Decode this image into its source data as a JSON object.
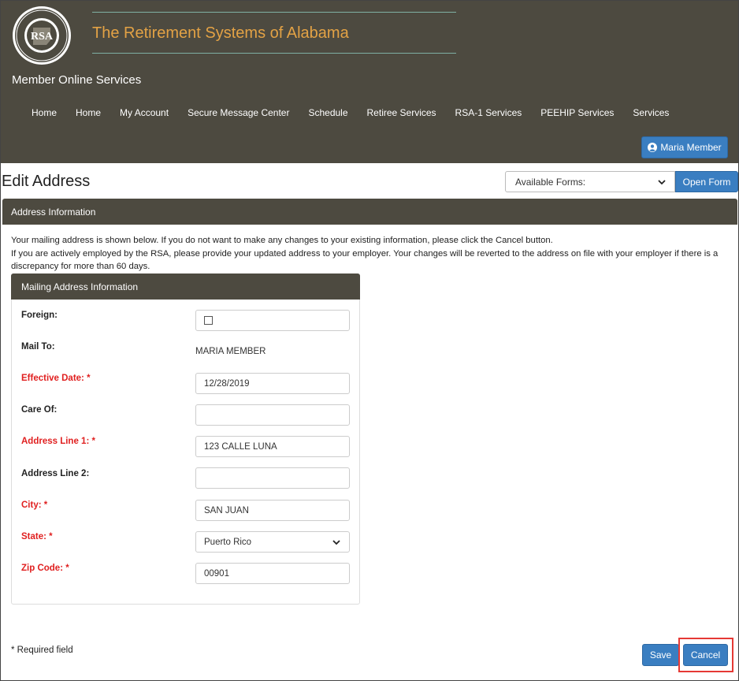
{
  "header": {
    "logo_icon": "rsa-seal-logo",
    "site_title": "The Retirement Systems of Alabama",
    "app_title": "Member Online Services",
    "nav": [
      {
        "label": "Home"
      },
      {
        "label": "Home"
      },
      {
        "label": "My Account"
      },
      {
        "label": "Secure Message Center"
      },
      {
        "label": "Schedule"
      },
      {
        "label": "Retiree Services"
      },
      {
        "label": "RSA-1 Services"
      },
      {
        "label": "PEEHIP Services"
      },
      {
        "label": "Services"
      }
    ],
    "member_button": {
      "label": "Maria Member",
      "icon": "user-circle-icon"
    }
  },
  "page": {
    "title": "Edit Address",
    "forms_select": {
      "selected": "Available Forms:"
    },
    "open_form_label": "Open Form"
  },
  "panel": {
    "title": "Address Information",
    "intro_line1": "Your mailing address is shown below. If you do not want to make any changes to your existing information, please click the Cancel button.",
    "intro_line2": "If you are actively employed by the RSA, please provide your updated address to your employer. Your changes will be reverted to the address on file with your employer if there is a discrepancy for more than 60 days."
  },
  "card": {
    "title": "Mailing Address Information",
    "fields": {
      "foreign": {
        "label": "Foreign:",
        "checked": false
      },
      "mail_to": {
        "label": "Mail To:",
        "value": "MARIA MEMBER"
      },
      "effective_date": {
        "label": "Effective Date: *",
        "value": "12/28/2019"
      },
      "care_of": {
        "label": "Care Of:",
        "value": ""
      },
      "address1": {
        "label": "Address Line 1: *",
        "value": "123 CALLE LUNA"
      },
      "address2": {
        "label": "Address Line 2:",
        "value": ""
      },
      "city": {
        "label": "City: *",
        "value": "SAN JUAN"
      },
      "state": {
        "label": "State: *",
        "value": "Puerto Rico"
      },
      "zip": {
        "label": "Zip Code: *",
        "value": "00901"
      }
    }
  },
  "footer": {
    "required_note": "* Required field",
    "save_label": "Save",
    "cancel_label": "Cancel"
  },
  "colors": {
    "header_bg": "#4d4a40",
    "title_accent": "#e3a245",
    "button_blue": "#3a7ec1",
    "required_red": "#e02020",
    "highlight_red": "#e53935"
  }
}
